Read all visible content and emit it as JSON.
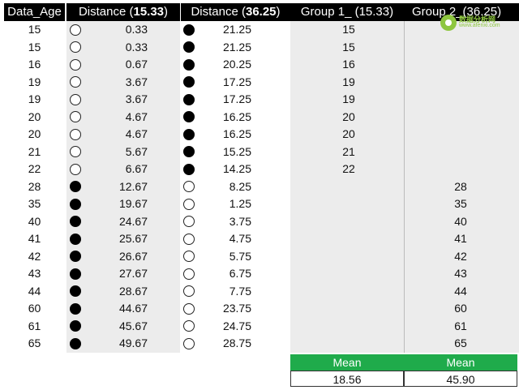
{
  "headers": {
    "age": "Data_Age",
    "distance1_prefix": "Distance (",
    "distance1_value": "15.33",
    "distance1_suffix": ")",
    "distance2_prefix": "Distance (",
    "distance2_value": "36.25",
    "distance2_suffix": ")",
    "group1": "Group 1_ (15.33)",
    "group2": "Group 2_(36.25)"
  },
  "rows": [
    {
      "age": "15",
      "d1": "0.33",
      "d1_marker": "open",
      "d2": "21.25",
      "d2_marker": "filled",
      "g1": "15",
      "g2": ""
    },
    {
      "age": "15",
      "d1": "0.33",
      "d1_marker": "open",
      "d2": "21.25",
      "d2_marker": "filled",
      "g1": "15",
      "g2": ""
    },
    {
      "age": "16",
      "d1": "0.67",
      "d1_marker": "open",
      "d2": "20.25",
      "d2_marker": "filled",
      "g1": "16",
      "g2": ""
    },
    {
      "age": "19",
      "d1": "3.67",
      "d1_marker": "open",
      "d2": "17.25",
      "d2_marker": "filled",
      "g1": "19",
      "g2": ""
    },
    {
      "age": "19",
      "d1": "3.67",
      "d1_marker": "open",
      "d2": "17.25",
      "d2_marker": "filled",
      "g1": "19",
      "g2": ""
    },
    {
      "age": "20",
      "d1": "4.67",
      "d1_marker": "open",
      "d2": "16.25",
      "d2_marker": "filled",
      "g1": "20",
      "g2": ""
    },
    {
      "age": "20",
      "d1": "4.67",
      "d1_marker": "open",
      "d2": "16.25",
      "d2_marker": "filled",
      "g1": "20",
      "g2": ""
    },
    {
      "age": "21",
      "d1": "5.67",
      "d1_marker": "open",
      "d2": "15.25",
      "d2_marker": "filled",
      "g1": "21",
      "g2": ""
    },
    {
      "age": "22",
      "d1": "6.67",
      "d1_marker": "open",
      "d2": "14.25",
      "d2_marker": "filled",
      "g1": "22",
      "g2": ""
    },
    {
      "age": "28",
      "d1": "12.67",
      "d1_marker": "filled",
      "d2": "8.25",
      "d2_marker": "open",
      "g1": "",
      "g2": "28"
    },
    {
      "age": "35",
      "d1": "19.67",
      "d1_marker": "filled",
      "d2": "1.25",
      "d2_marker": "open",
      "g1": "",
      "g2": "35"
    },
    {
      "age": "40",
      "d1": "24.67",
      "d1_marker": "filled",
      "d2": "3.75",
      "d2_marker": "open",
      "g1": "",
      "g2": "40"
    },
    {
      "age": "41",
      "d1": "25.67",
      "d1_marker": "filled",
      "d2": "4.75",
      "d2_marker": "open",
      "g1": "",
      "g2": "41"
    },
    {
      "age": "42",
      "d1": "26.67",
      "d1_marker": "filled",
      "d2": "5.75",
      "d2_marker": "open",
      "g1": "",
      "g2": "42"
    },
    {
      "age": "43",
      "d1": "27.67",
      "d1_marker": "filled",
      "d2": "6.75",
      "d2_marker": "open",
      "g1": "",
      "g2": "43"
    },
    {
      "age": "44",
      "d1": "28.67",
      "d1_marker": "filled",
      "d2": "7.75",
      "d2_marker": "open",
      "g1": "",
      "g2": "44"
    },
    {
      "age": "60",
      "d1": "44.67",
      "d1_marker": "filled",
      "d2": "23.75",
      "d2_marker": "open",
      "g1": "",
      "g2": "60"
    },
    {
      "age": "61",
      "d1": "45.67",
      "d1_marker": "filled",
      "d2": "24.75",
      "d2_marker": "open",
      "g1": "",
      "g2": "61"
    },
    {
      "age": "65",
      "d1": "49.67",
      "d1_marker": "filled",
      "d2": "28.75",
      "d2_marker": "open",
      "g1": "",
      "g2": "65"
    }
  ],
  "mean": {
    "label1": "Mean",
    "label2": "Mean",
    "value1": "18.56",
    "value2": "45.90"
  },
  "colors": {
    "header_bg": "#000000",
    "mean_header_bg": "#1fab4b",
    "shade": "#ececec"
  },
  "watermark": {
    "name": "数据分析网",
    "url": "www.afenxi.com"
  }
}
